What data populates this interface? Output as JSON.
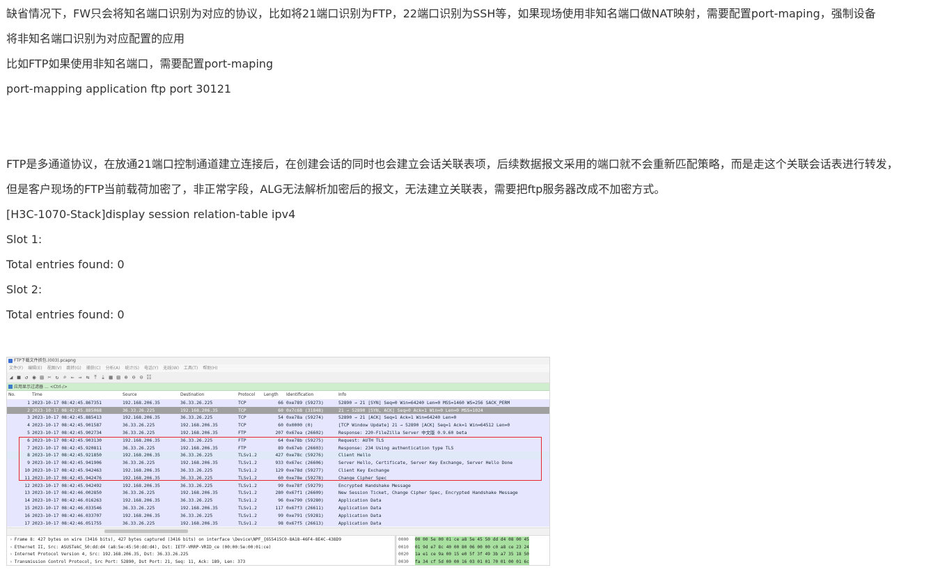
{
  "paragraphs": [
    "缺省情况下，FW只会将知名端口识别为对应的协议，比如将21端口识别为FTP，22端口识别为SSH等，如果现场使用非知名端口做NAT映射，需要配置port-maping，强制设备",
    "将非知名端口识别为对应配置的应用",
    "比如FTP如果使用非知名端口，需要配置port-maping",
    "port-mapping application ftp port 30121",
    "FTP是多通道协议，在放通21端口控制通道建立连接后，在创建会话的同时也会建立会话关联表项，后续数据报文采用的端口就不会重新匹配策略，而是走这个关联会话表进行转发，",
    "但是客户现场的FTP当前载荷加密了，非正常字段，ALG无法解析加密后的报文，无法建立关联表，需要把ftp服务器改成不加密方式。",
    "[H3C-1070-Stack]display session relation-table ipv4",
    "Slot 1:",
    "Total entries found: 0",
    "Slot 2:",
    "Total entries found: 0"
  ],
  "screenshot": {
    "title": "FTP下载文件抓包.(003).pcapng",
    "menu": [
      "文件(F)",
      "编辑(E)",
      "视图(V)",
      "跳转(G)",
      "捕获(C)",
      "分析(A)",
      "统计(S)",
      "电话(Y)",
      "无线(W)",
      "工具(T)",
      "帮助(H)"
    ],
    "toolbar_icons": [
      "◢",
      "■",
      "↺",
      "◉",
      "▤",
      "✂",
      "↻",
      "⌕",
      "⇐",
      "⇒",
      "⇆",
      "⤒",
      "⤓",
      "▦",
      "▤",
      "⊕",
      "⊖",
      "⊙",
      "☷"
    ],
    "filter_placeholder": "应用显示过滤器 … <Ctrl-/>",
    "columns": [
      "No.",
      "Time",
      "Source",
      "Destination",
      "Protocol",
      "Length",
      "Identification",
      "Info"
    ],
    "colors": {
      "tcp_gray": "#a0a0a0",
      "tcp_light": "#e7e6ff",
      "selected": "#dfe9f7",
      "box_red": "#e8262a"
    },
    "packets": [
      {
        "no": "1",
        "time": "2023-10-17 08:42:45.867351",
        "src": "192.168.206.35",
        "dst": "36.33.26.225",
        "proto": "TCP",
        "len": "66",
        "id": "0xe789 (59273)",
        "info": "52890 → 21 [SYN] Seq=0 Win=64240 Len=0 MSS=1460 WS=256 SACK_PERM",
        "bg": "#e7e6ff"
      },
      {
        "no": "2",
        "time": "2023-10-17 08:42:45.885068",
        "src": "36.33.26.225",
        "dst": "192.168.206.35",
        "proto": "TCP",
        "len": "60",
        "id": "0x7c68 (31848)",
        "info": "21 → 52890 [SYN, ACK] Seq=0 Ack=1 Win=0 Len=0 MSS=1024",
        "bg": "#a0a0a0"
      },
      {
        "no": "3",
        "time": "2023-10-17 08:42:45.885413",
        "src": "192.168.206.35",
        "dst": "36.33.26.225",
        "proto": "TCP",
        "len": "54",
        "id": "0xe78a (59274)",
        "info": "52890 → 21 [ACK] Seq=1 Ack=1 Win=64240 Len=0",
        "bg": "#e7e6ff"
      },
      {
        "no": "4",
        "time": "2023-10-17 08:42:45.901587",
        "src": "36.33.26.225",
        "dst": "192.168.206.35",
        "proto": "TCP",
        "len": "60",
        "id": "0x0000 (0)",
        "info": "[TCP Window Update] 21 → 52890 [ACK] Seq=1 Ack=1 Win=64512 Len=0",
        "bg": "#e7e6ff"
      },
      {
        "no": "5",
        "time": "2023-10-17 08:42:45.902734",
        "src": "36.33.26.225",
        "dst": "192.168.206.35",
        "proto": "FTP",
        "len": "207",
        "id": "0x67ea (26602)",
        "info": "Response: 220-FileZilla Server 中文版 0.9.60 beta",
        "bg": "#e7e6ff"
      },
      {
        "no": "6",
        "time": "2023-10-17 08:42:45.903130",
        "src": "192.168.206.35",
        "dst": "36.33.26.225",
        "proto": "FTP",
        "len": "64",
        "id": "0xe78b (59275)",
        "info": "Request: AUTH TLS",
        "bg": "#e7e6ff"
      },
      {
        "no": "7",
        "time": "2023-10-17 08:42:45.920811",
        "src": "36.33.26.225",
        "dst": "192.168.206.35",
        "proto": "FTP",
        "len": "89",
        "id": "0x67eb (26603)",
        "info": "Response: 234 Using authentication type TLS",
        "bg": "#e7e6ff"
      },
      {
        "no": "8",
        "time": "2023-10-17 08:42:45.921850",
        "src": "192.168.206.35",
        "dst": "36.33.26.225",
        "proto": "TLSv1.2",
        "len": "427",
        "id": "0xe78c (59276)",
        "info": "Client Hello",
        "bg": "#dfe9f7"
      },
      {
        "no": "9",
        "time": "2023-10-17 08:42:45.941906",
        "src": "36.33.26.225",
        "dst": "192.168.206.35",
        "proto": "TLSv1.2",
        "len": "933",
        "id": "0x67ec (26606)",
        "info": "Server Hello, Certificate, Server Key Exchange, Server Hello Done",
        "bg": "#e7e6ff"
      },
      {
        "no": "10",
        "time": "2023-10-17 08:42:45.942463",
        "src": "192.168.206.35",
        "dst": "36.33.26.225",
        "proto": "TLSv1.2",
        "len": "129",
        "id": "0xe78d (59277)",
        "info": "Client Key Exchange",
        "bg": "#e7e6ff"
      },
      {
        "no": "11",
        "time": "2023-10-17 08:42:45.942476",
        "src": "192.168.206.35",
        "dst": "36.33.26.225",
        "proto": "TLSv1.2",
        "len": "60",
        "id": "0xe78e (59278)",
        "info": "Change Cipher Spec",
        "bg": "#e7e6ff"
      },
      {
        "no": "12",
        "time": "2023-10-17 08:42:45.942492",
        "src": "192.168.206.35",
        "dst": "36.33.26.225",
        "proto": "TLSv1.2",
        "len": "99",
        "id": "0xe78f (59279)",
        "info": "Encrypted Handshake Message",
        "bg": "#e7e6ff"
      },
      {
        "no": "13",
        "time": "2023-10-17 08:42:46.002850",
        "src": "36.33.26.225",
        "dst": "192.168.206.35",
        "proto": "TLSv1.2",
        "len": "280",
        "id": "0x67f1 (26609)",
        "info": "New Session Ticket, Change Cipher Spec, Encrypted Handshake Message",
        "bg": "#e7e6ff"
      },
      {
        "no": "14",
        "time": "2023-10-17 08:42:46.016263",
        "src": "192.168.206.35",
        "dst": "36.33.26.225",
        "proto": "TLSv1.2",
        "len": "96",
        "id": "0xe790 (59280)",
        "info": "Application Data",
        "bg": "#e7e6ff"
      },
      {
        "no": "15",
        "time": "2023-10-17 08:42:46.033546",
        "src": "36.33.26.225",
        "dst": "192.168.206.35",
        "proto": "TLSv1.2",
        "len": "117",
        "id": "0x67f3 (26611)",
        "info": "Application Data",
        "bg": "#e7e6ff"
      },
      {
        "no": "16",
        "time": "2023-10-17 08:42:46.033707",
        "src": "192.168.206.35",
        "dst": "36.33.26.225",
        "proto": "TLSv1.2",
        "len": "99",
        "id": "0xe791 (59281)",
        "info": "Application Data",
        "bg": "#e7e6ff"
      },
      {
        "no": "17",
        "time": "2023-10-17 08:42:46.051755",
        "src": "36.33.26.225",
        "dst": "192.168.206.35",
        "proto": "TLSv1.2",
        "len": "98",
        "id": "0x67f5 (26613)",
        "info": "Application Data",
        "bg": "#e7e6ff"
      }
    ],
    "details": [
      "Frame 8: 427 bytes on wire (3416 bits), 427 bytes captured (3416 bits) on interface \\Device\\NPF_{655415C0-8A18-46F4-8E4C-438D9",
      "Ethernet II, Src: ASUSTekC_50:dd:d4 (a8:5e:45:50:dd:d4), Dst: IETF-VRRP-VRID_ce (00:00:5e:00:01:ce)",
      "Internet Protocol Version 4, Src: 192.168.206.35, Dst: 36.33.26.225",
      "Transmission Control Protocol, Src Port: 52890, Dst Port: 21, Seq: 11, Ack: 189, Len: 373"
    ],
    "hex": [
      {
        "off": "0000",
        "bytes": "00 00 5e 00 01 ce a8 5e  45 50 dd d4 08 00 45"
      },
      {
        "off": "0010",
        "bytes": "01 9d e7 8c 40 00 80 06  00 00 c0 a8 ce 23 24"
      },
      {
        "off": "0020",
        "bytes": "1a e1 ce 9a 00 15 e0 5f  3f 49 3b a7 35 18 50"
      },
      {
        "off": "0030",
        "bytes": "fa 34 cf 5d 00 00 16 03  01 01 70 01 00 01 6c"
      }
    ]
  }
}
